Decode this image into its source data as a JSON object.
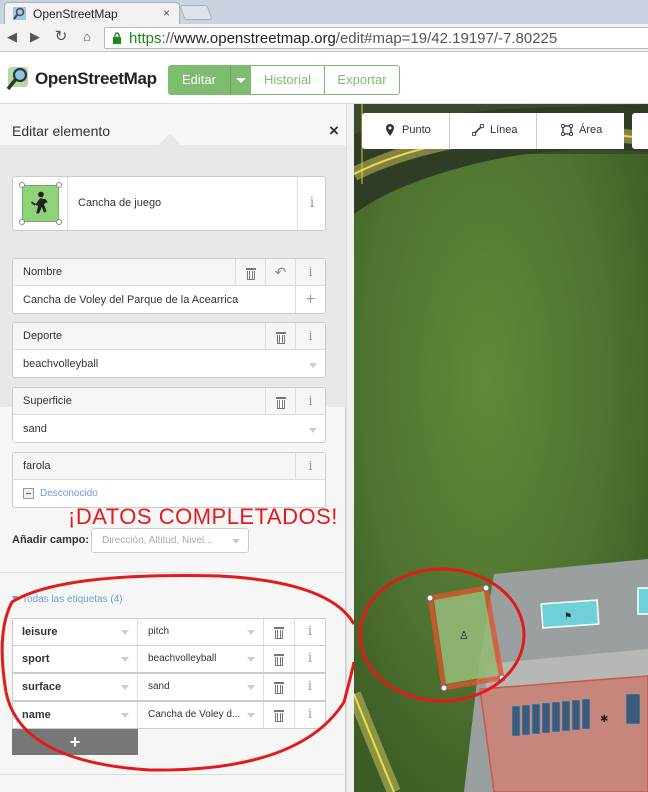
{
  "browser": {
    "tab_title": "OpenStreetMap",
    "tab_close": "×",
    "url_scheme": "https",
    "url_sep": "://",
    "url_host": "www.openstreetmap.org",
    "url_path": "/edit#map=19/42.19197/-7.80225"
  },
  "header": {
    "brand": "OpenStreetMap",
    "edit_label": "Editar",
    "history_label": "Historial",
    "export_label": "Exportar"
  },
  "sidebar": {
    "title": "Editar elemento",
    "close": "×",
    "preset": {
      "label": "Cancha de juego",
      "info": "i"
    },
    "fields": [
      {
        "label": "Nombre",
        "value": "Cancha de Voley del Parque de la Acearrica"
      },
      {
        "label": "Deporte",
        "value": "beachvolleyball"
      },
      {
        "label": "Superficie",
        "value": "sand"
      },
      {
        "label": "farola",
        "value": "Desconocido"
      }
    ],
    "info_glyph": "i",
    "undo_glyph": "↶",
    "plus_glyph": "+",
    "add_field_label": "Añadir campo:",
    "add_field_placeholder": "Dirección, Altitud, Nivel...",
    "all_tags_label": "Todas las etiquetas (4)",
    "tags": [
      {
        "key": "leisure",
        "value": "pitch"
      },
      {
        "key": "sport",
        "value": "beachvolleyball"
      },
      {
        "key": "surface",
        "value": "sand"
      },
      {
        "key": "name",
        "value": "Cancha de Voley d..."
      }
    ],
    "add_tag_glyph": "+"
  },
  "annotation": {
    "text": "¡DATOS COMPLETADOS!",
    "color": "#e31a1a"
  },
  "map": {
    "tools": [
      {
        "label": "Punto"
      },
      {
        "label": "Línea"
      },
      {
        "label": "Área"
      }
    ]
  },
  "colors": {
    "accent": "#7ebc6f",
    "link": "#6a9fd4",
    "highlight": "#e0542c"
  }
}
